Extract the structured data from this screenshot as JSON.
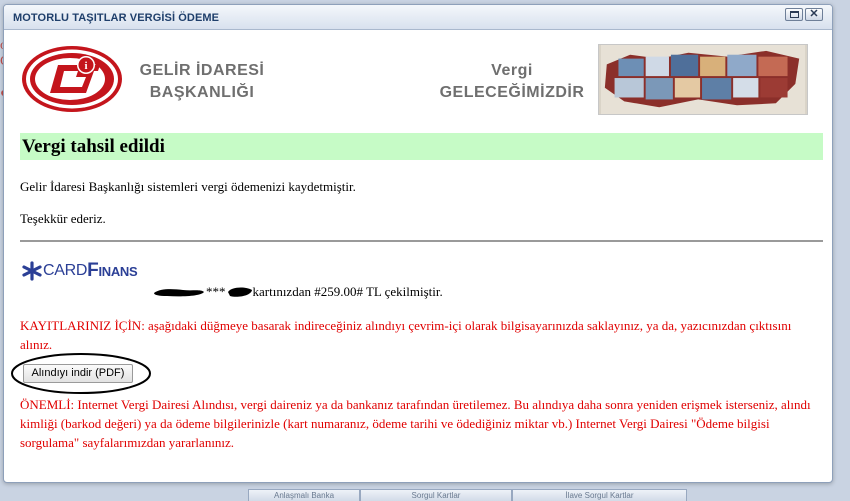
{
  "window": {
    "title": "MOTORLU TAŞITLAR VERGİSİ ÖDEME"
  },
  "header": {
    "org_line1": "GELİR İDARESİ",
    "org_line2": "BAŞKANLIĞI",
    "slogan_line1": "Vergi",
    "slogan_line2": "GELECEĞİMİZDİR"
  },
  "status": {
    "heading": "Vergi tahsil edildi",
    "message": "Gelir İdaresi Başkanlığı sistemleri vergi ödemenizi kaydetmiştir.",
    "thanks": "Teşekkür ederiz."
  },
  "payment": {
    "card_brand_prefix": "CARD",
    "card_brand_suffix": "Finans",
    "card_mask_stars": "***",
    "charge_text": "kartınızdan #259.00# TL çekilmiştir."
  },
  "notice": {
    "records_text": "KAYITLARINIZ İÇİN: aşağıdaki düğmeye basarak indireceğiniz alındıyı çevrim-içi olarak bilgisayarınızda saklayınız, ya da, yazıcınızdan çıktısını alınız.",
    "download_label": "Alındıyı indir (PDF)",
    "important_text": "ÖNEMLİ: Internet Vergi Dairesi Alındısı, vergi daireniz ya da bankanız tarafından üretilemez. Bu alındıya daha sonra yeniden erişmek isterseniz, alındı kimliği (barkod değeri) ya da ödeme bilgilerinizle (kart numaranız, ödeme tarihi ve ödediğiniz miktar vb.) Internet Vergi Dairesi \"Ödeme bilgisi sorgulama\" sayfalarımızdan yararlanınız."
  },
  "background_tabs": [
    "Anlaşmalı Banka",
    "Sorgul Kartlar",
    "İlave Sorgul Kartlar"
  ],
  "colors": {
    "success_bg": "#c6fbc6",
    "warning_text": "#e00000",
    "logo_red": "#c4151c",
    "brand_blue": "#2b3f96"
  }
}
